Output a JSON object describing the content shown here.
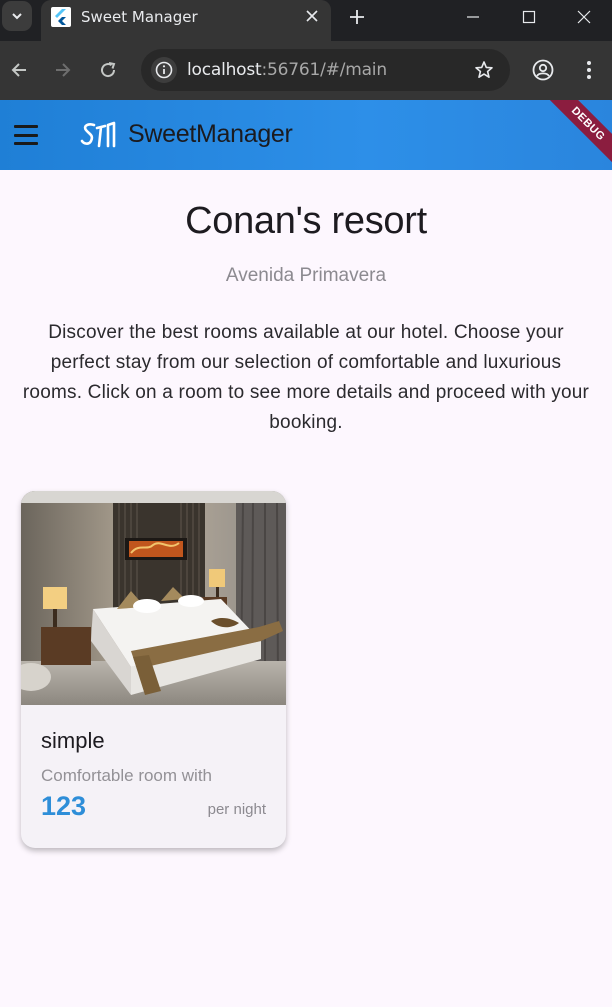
{
  "browser": {
    "tab_title": "Sweet Manager",
    "url_host": "localhost",
    "url_rest": ":56761/#/main"
  },
  "appbar": {
    "brand": "SweetManager",
    "debug_label": "DEBUG"
  },
  "hotel": {
    "name": "Conan's resort",
    "address": "Avenida Primavera",
    "description": "Discover the best rooms available at our hotel. Choose your perfect stay from our selection of comfortable and luxurious rooms. Click on a room to see more details and proceed with your booking."
  },
  "rooms": [
    {
      "title": "simple",
      "description": "Comfortable room with",
      "price": "123",
      "price_unit": "per night"
    }
  ],
  "colors": {
    "appbar": "#2d8fe8",
    "accent_price": "#2e8ed8",
    "debug_banner": "#8b1d3f"
  }
}
